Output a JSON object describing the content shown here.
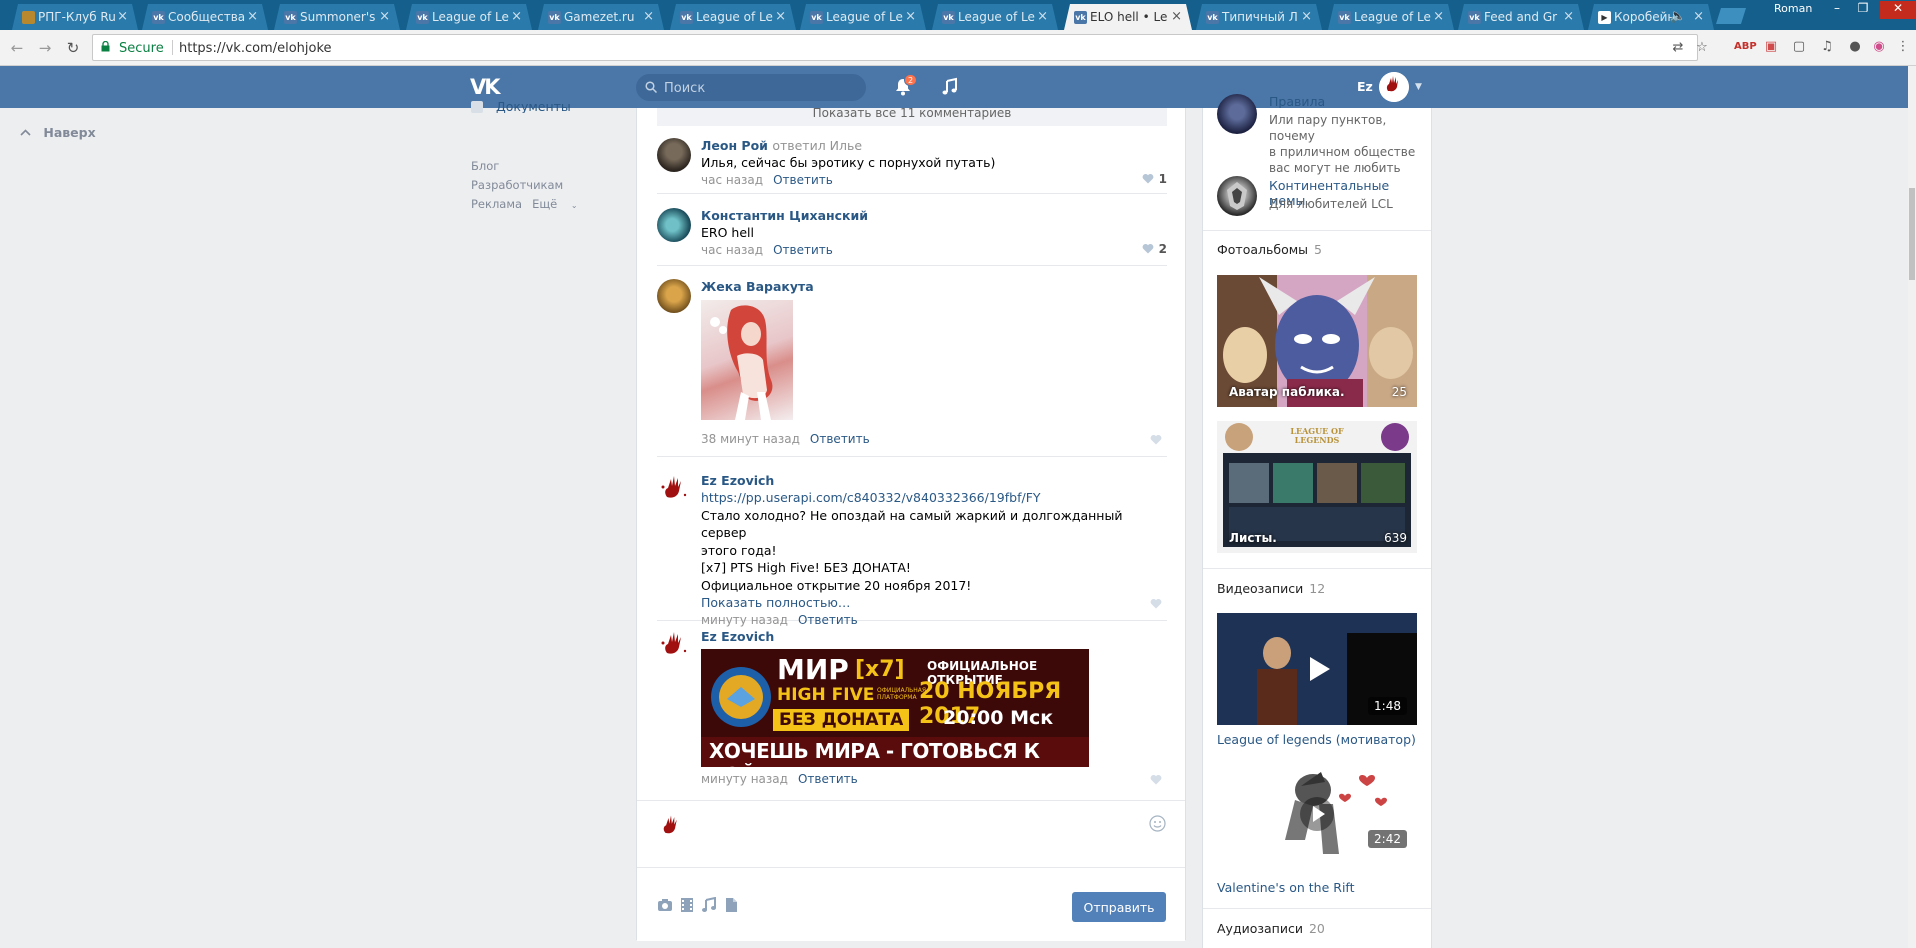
{
  "browser": {
    "tabs": [
      {
        "title": "РПГ-Клуб Ru",
        "active": false
      },
      {
        "title": "Сообщества",
        "active": false
      },
      {
        "title": "Summoner's",
        "active": false
      },
      {
        "title": "League of Le",
        "active": false
      },
      {
        "title": "Gamezet.ru",
        "active": false
      },
      {
        "title": "League of Le",
        "active": false
      },
      {
        "title": "League of Le",
        "active": false
      },
      {
        "title": "League of Le",
        "active": false
      },
      {
        "title": "ELO hell • Le",
        "active": true
      },
      {
        "title": "Типичный Л",
        "active": false
      },
      {
        "title": "League of Le",
        "active": false
      },
      {
        "title": "Feed and Gr",
        "active": false
      },
      {
        "title": "Коробейн",
        "active": false
      }
    ],
    "profile_name": "Roman",
    "secure_label": "Secure",
    "url": "https://vk.com/elohjoke"
  },
  "header": {
    "search_placeholder": "Поиск",
    "notification_count": "2",
    "user_name": "Ez"
  },
  "left": {
    "to_top": "Наверх",
    "docs": "Документы",
    "footer_links": [
      "Блог",
      "Разработчикам",
      "Реклама",
      "Ещё"
    ]
  },
  "comments": {
    "show_all": "Показать все 11 комментариев",
    "reply_label": "Ответить",
    "items": [
      {
        "author": "Леон Рой",
        "replied": "ответил Илье",
        "text": "Илья, сейчас бы эротику с порнухой путать)",
        "time": "час назад",
        "likes": "1"
      },
      {
        "author": "Константин Циханский",
        "text": "ERO hell",
        "time": "час назад",
        "likes": "2"
      },
      {
        "author": "Жека Варакута",
        "time": "38 минут назад",
        "likes": ""
      },
      {
        "author": "Ez Ezovich",
        "link": "https://pp.userapi.com/c840332/v840332366/19fbf/FYn-_...",
        "lines": [
          "Стало холодно? Не опоздай на самый жаркий и долгожданный сервер",
          "этого года!",
          "[x7] PTS High Five! БЕЗ ДОНАТА!",
          "Официальное открытие 20 ноября 2017!"
        ],
        "more": "Показать полностью…",
        "time": "минуту назад",
        "likes": ""
      },
      {
        "author": "Ez Ezovich",
        "time": "минуту назад",
        "likes": ""
      }
    ],
    "banner": {
      "line1": "МИР",
      "tag": "[x7]",
      "line2": "HIGH FIVE",
      "platform": "ОФИЦИАЛЬНАЯ ПЛАТФОРМА",
      "no_donate": "БЕЗ ДОНАТА",
      "opening": "ОФИЦИАЛЬНОЕ ОТКРЫТИЕ",
      "date": "20 НОЯБРЯ 2017",
      "time": "20:00 Мск",
      "slogan": "ХОЧЕШЬ МИРА - ГОТОВЬСЯ К ВОЙНЕ"
    }
  },
  "compose": {
    "placeholder": "",
    "send_label": "Отправить"
  },
  "sidebar": {
    "groups": [
      {
        "name": "Правила",
        "desc": [
          "Или пару пунктов, почему",
          "в приличном обществе",
          "вас могут не любить"
        ]
      },
      {
        "name": "Континентальные мемы",
        "desc": [
          "Для любителей LCL"
        ]
      }
    ],
    "albums_title": "Фотоальбомы",
    "albums_count": "5",
    "albums": [
      {
        "name": "Аватар паблика.",
        "count": "25"
      },
      {
        "name": "Листы.",
        "count": "639"
      }
    ],
    "league_logo": "LEAGUE OF LEGENDS",
    "videos_title": "Видеозаписи",
    "videos_count": "12",
    "videos": [
      {
        "title": "League of legends (мотиватор)",
        "duration": "1:48"
      },
      {
        "title": "Valentine's on the Rift",
        "duration": "2:42"
      }
    ],
    "audio_title": "Аудиозаписи",
    "audio_count": "20"
  },
  "colors": {
    "vk_blue": "#4a76a8",
    "link": "#2a5885",
    "chrome_tabstrip": "#145f8c"
  }
}
